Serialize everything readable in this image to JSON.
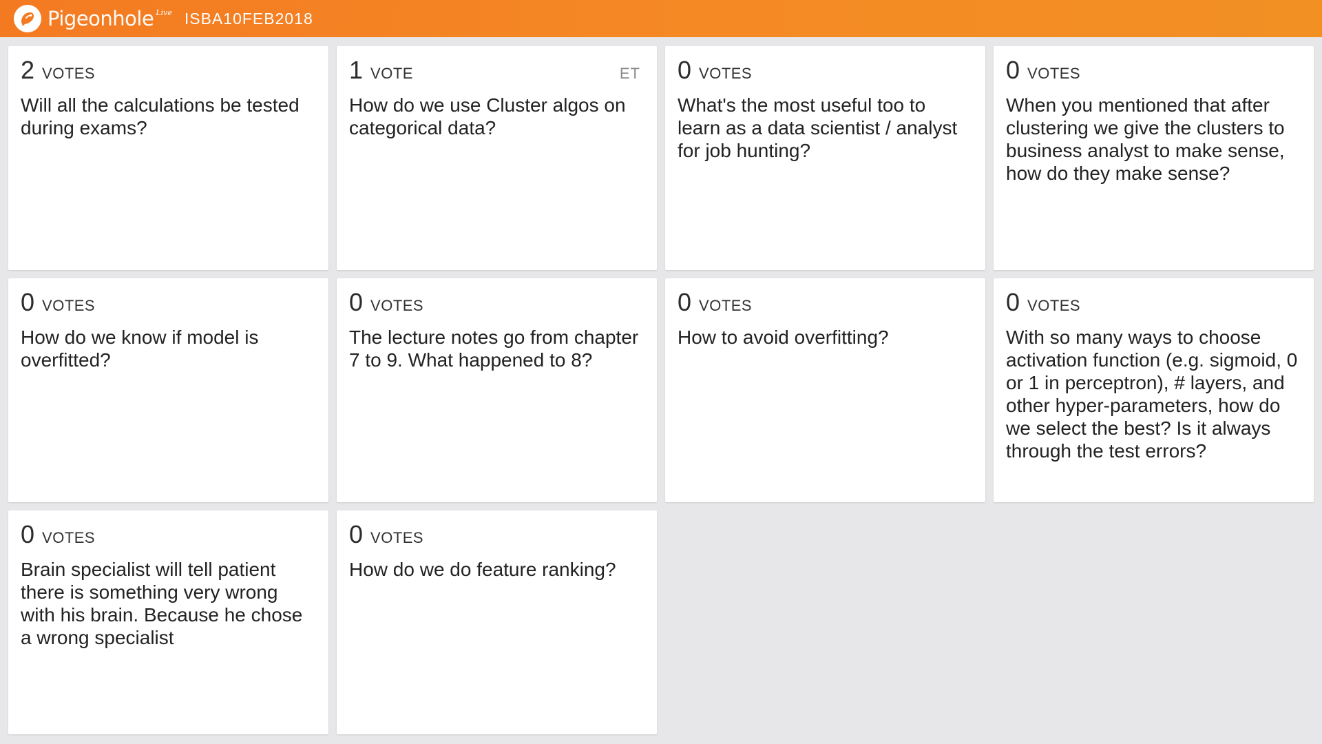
{
  "header": {
    "brand": "Pigeonhole",
    "brand_sup": "Live",
    "event_code": "ISBA10FEB2018",
    "brand_color": "#f47a22"
  },
  "cards": [
    {
      "count": "2",
      "label": "VOTES",
      "tag": "",
      "question": "Will all the calculations be tested during exams?"
    },
    {
      "count": "1",
      "label": "VOTE",
      "tag": "ET",
      "question": "How do we use Cluster algos on categorical data?"
    },
    {
      "count": "0",
      "label": "VOTES",
      "tag": "",
      "question": "What's the most useful too to learn as a data scientist / analyst for job hunting?"
    },
    {
      "count": "0",
      "label": "VOTES",
      "tag": "",
      "question": "When you mentioned that after clustering we give the clusters to business analyst to make sense, how do they make sense?"
    },
    {
      "count": "0",
      "label": "VOTES",
      "tag": "",
      "question": "How do we know if model is overfitted?"
    },
    {
      "count": "0",
      "label": "VOTES",
      "tag": "",
      "question": "The lecture notes go from chapter 7 to 9. What happened to 8?"
    },
    {
      "count": "0",
      "label": "VOTES",
      "tag": "",
      "question": "How to avoid overfitting?"
    },
    {
      "count": "0",
      "label": "VOTES",
      "tag": "",
      "question": "With so many ways to choose activation function (e.g. sigmoid, 0 or 1 in perceptron), # layers, and other hyper-parameters, how do we select the best? Is it always through the test errors?"
    },
    {
      "count": "0",
      "label": "VOTES",
      "tag": "",
      "question": "Brain specialist will tell patient there is something very wrong with his brain. Because he chose a wrong specialist"
    },
    {
      "count": "0",
      "label": "VOTES",
      "tag": "",
      "question": "How do we do feature ranking?"
    }
  ]
}
